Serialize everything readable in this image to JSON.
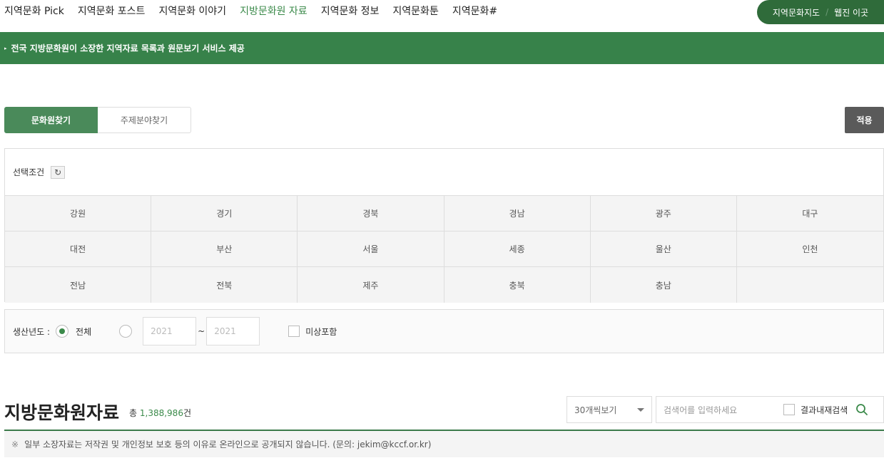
{
  "nav": {
    "items": [
      "지역문화 Pick",
      "지역문화 포스트",
      "지역문화 이야기",
      "지방문화원 자료",
      "지역문화 정보",
      "지역문화툰",
      "지역문화#"
    ],
    "active_index": 3,
    "pill_left": "지역문화지도",
    "pill_sep": "/",
    "pill_right": "웹진 이곳"
  },
  "banner": {
    "marker": "▸",
    "text": "전국 지방문화원이 소장한 지역자료 목록과 원문보기 서비스 제공"
  },
  "tabs": {
    "culture_center": "문화원찾기",
    "subject": "주제분야찾기"
  },
  "apply_label": "적용",
  "condition": {
    "label": "선택조건",
    "reset_icon": "↻",
    "regions": [
      "강원",
      "경기",
      "경북",
      "경남",
      "광주",
      "대구",
      "대전",
      "부산",
      "서울",
      "세종",
      "울산",
      "인천",
      "전남",
      "전북",
      "제주",
      "충북",
      "충남"
    ]
  },
  "year": {
    "label": "생산년도 :",
    "all_label": "전체",
    "from": "2021",
    "tilde": "~",
    "to": "2021",
    "unknown_label": "미상포함"
  },
  "results": {
    "title": "지방문화원자료",
    "total_prefix": "총",
    "total_count": "1,388,986",
    "total_suffix": "건"
  },
  "page_size": {
    "selected": "30개씩보기"
  },
  "search": {
    "placeholder": "검색어를 입력하세요",
    "within_label": "결과내재검색"
  },
  "notice": {
    "marker": "※",
    "text": "일부 소장자료는 저작권 및 개인정보 보호 등의 이유로 온라인으로 공개되지 않습니다. (문의: jekim@kccf.or.kr)"
  },
  "colors": {
    "brand_green": "#37824a",
    "dark_green": "#2f6b3a",
    "apply_gray": "#5a5a5a"
  }
}
